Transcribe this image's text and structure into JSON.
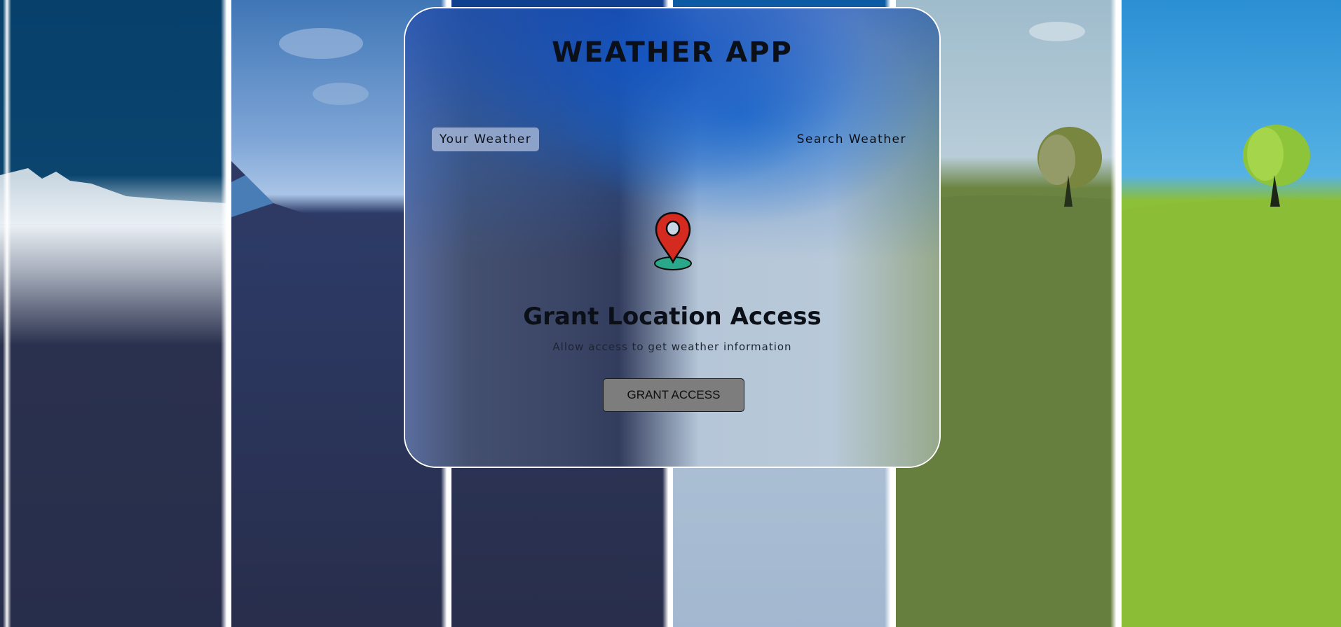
{
  "app": {
    "title": "WEATHER APP"
  },
  "tabs": [
    {
      "label": "Your Weather",
      "active": true
    },
    {
      "label": "Search Weather",
      "active": false
    }
  ],
  "location_panel": {
    "icon": "location-pin-icon",
    "heading": "Grant Location Access",
    "description": "Allow access to get weather information",
    "button_label": "GRANT ACCESS"
  },
  "colors": {
    "pin_red": "#d42a1f",
    "pin_base": "#2aa88a",
    "button_bg": "#7d7d7d",
    "card_border": "#ffffff",
    "active_tab_bg": "#dce4f5"
  },
  "background_scenes": [
    {
      "name": "night-snow-scene"
    },
    {
      "name": "dusk-mountain-scene"
    },
    {
      "name": "blue-sky-scene"
    },
    {
      "name": "overcast-scene"
    },
    {
      "name": "cloudy-tree-scene"
    },
    {
      "name": "sunny-tree-scene"
    }
  ]
}
